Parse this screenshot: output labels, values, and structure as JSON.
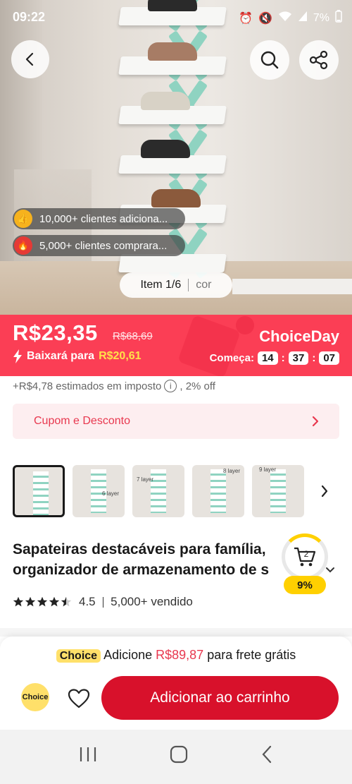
{
  "status_bar": {
    "time": "09:22",
    "battery": "7%"
  },
  "hero": {
    "social_proof": [
      {
        "icon": "thumbs-up-icon",
        "text": "10,000+ clientes adiciona..."
      },
      {
        "icon": "fire-icon",
        "text": "5,000+ clientes comprara..."
      }
    ],
    "image_counter": "Item 1/6",
    "variant_label": "cor"
  },
  "price": {
    "current": "R$23,35",
    "original": "R$68,69",
    "drop_label": "Baixará para",
    "drop_value": "R$20,61",
    "event": "ChoiceDay",
    "starts_label": "Começa:",
    "timer": {
      "h": "14",
      "m": "37",
      "s": "07"
    }
  },
  "tax_note": {
    "text": "+R$4,78 estimados em imposto",
    "discount": ", 2% off"
  },
  "coupon": {
    "label": "Cupom e Desconto"
  },
  "thumbnails": [
    {
      "label": ""
    },
    {
      "label": "6 layer"
    },
    {
      "label": "7 layer"
    },
    {
      "label": "8 layer"
    },
    {
      "label": "9 layer"
    }
  ],
  "product": {
    "title_line1": "Sapateiras destacáveis para família,",
    "title_line2": "organizador de armazenamento de s",
    "rating": "4.5",
    "sold": "5,000+ vendido"
  },
  "cart_badge": {
    "count": "2",
    "percent": "9%"
  },
  "bottom": {
    "choice_tag": "Choice",
    "freeship_prefix": "Adicione",
    "freeship_amount": "R$89,87",
    "freeship_suffix": "para frete grátis",
    "choice_logo": "Choice",
    "add_to_cart": "Adicionar ao carrinho"
  },
  "colors": {
    "accent": "#fb3e55",
    "cart_button": "#d8112b",
    "choice_yellow": "#ffe06a",
    "rack_teal": "#8fd3c1"
  }
}
